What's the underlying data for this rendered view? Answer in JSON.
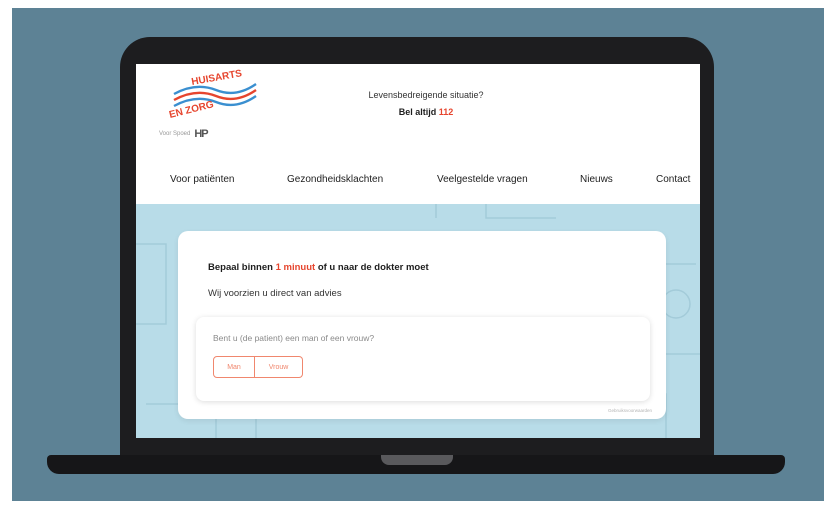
{
  "logo": {
    "line1": "HUISARTS",
    "line2": "EN ZORG",
    "sponsor_text": "Voor Spoed",
    "sponsor_mark": "HP"
  },
  "emergency": {
    "question": "Levensbedreigende situatie?",
    "call_prefix": "Bel altijd",
    "number": "112"
  },
  "nav": {
    "items": [
      {
        "label": "Voor patiënten"
      },
      {
        "label": "Gezondheidsklachten"
      },
      {
        "label": "Veelgestelde vragen"
      },
      {
        "label": "Nieuws"
      },
      {
        "label": "Contact"
      }
    ]
  },
  "card": {
    "title_prefix": "Bepaal binnen",
    "title_accent": "1 minuut",
    "title_suffix": "of u naar de dokter moet",
    "subtitle": "Wij voorzien u direct van advies",
    "question": "Bent u (de patient) een man of een vrouw?",
    "choices": [
      "Man",
      "Vrouw"
    ],
    "footnote": "Gebruiksvoorwaarden"
  },
  "colors": {
    "frame_background": "#5d8295",
    "laptop": "#1d1d1f",
    "screen_background": "#b8dce8",
    "accent": "#e6452e",
    "choice_border": "#f0876e",
    "logo_blue": "#3a8fd0"
  }
}
